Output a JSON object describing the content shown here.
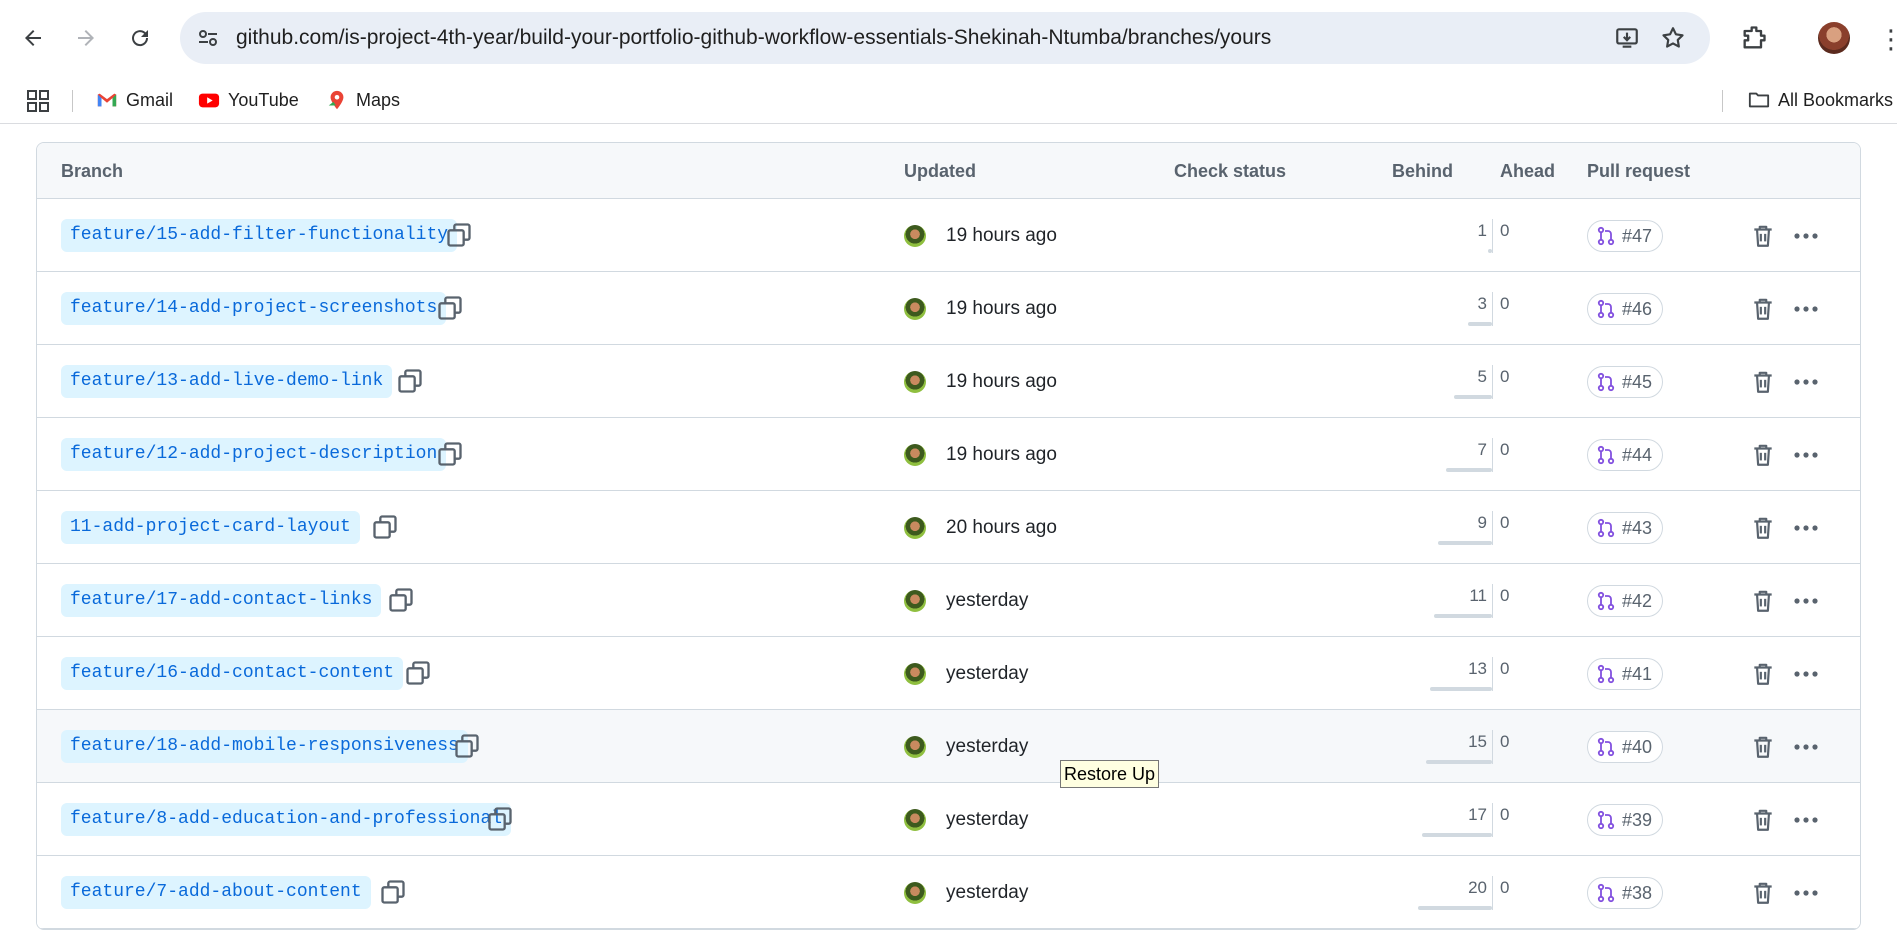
{
  "browser": {
    "url": "github.com/is-project-4th-year/build-your-portfolio-github-workflow-essentials-Shekinah-Ntumba/branches/yours",
    "bookmarks": [
      {
        "label": "Gmail",
        "icon": "gmail-icon"
      },
      {
        "label": "YouTube",
        "icon": "youtube-icon"
      },
      {
        "label": "Maps",
        "icon": "maps-icon"
      }
    ],
    "all_bookmarks_label": "All Bookmarks"
  },
  "table": {
    "headers": {
      "branch": "Branch",
      "updated": "Updated",
      "check_status": "Check status",
      "behind": "Behind",
      "ahead": "Ahead",
      "pull_request": "Pull request"
    },
    "rows": [
      {
        "branch": "feature/15-add-filter-functionality",
        "updated": "19 hours ago",
        "behind": "1",
        "ahead": "0",
        "pr": "#47"
      },
      {
        "branch": "feature/14-add-project-screenshots",
        "updated": "19 hours ago",
        "behind": "3",
        "ahead": "0",
        "pr": "#46"
      },
      {
        "branch": "feature/13-add-live-demo-link",
        "updated": "19 hours ago",
        "behind": "5",
        "ahead": "0",
        "pr": "#45"
      },
      {
        "branch": "feature/12-add-project-description",
        "updated": "19 hours ago",
        "behind": "7",
        "ahead": "0",
        "pr": "#44"
      },
      {
        "branch": "11-add-project-card-layout",
        "updated": "20 hours ago",
        "behind": "9",
        "ahead": "0",
        "pr": "#43"
      },
      {
        "branch": "feature/17-add-contact-links",
        "updated": "yesterday",
        "behind": "11",
        "ahead": "0",
        "pr": "#42"
      },
      {
        "branch": "feature/16-add-contact-content",
        "updated": "yesterday",
        "behind": "13",
        "ahead": "0",
        "pr": "#41"
      },
      {
        "branch": "feature/18-add-mobile-responsiveness",
        "updated": "yesterday",
        "behind": "15",
        "ahead": "0",
        "pr": "#40"
      },
      {
        "branch": "feature/8-add-education-and-professional",
        "updated": "yesterday",
        "behind": "17",
        "ahead": "0",
        "pr": "#39"
      },
      {
        "branch": "feature/7-add-about-content",
        "updated": "yesterday",
        "behind": "20",
        "ahead": "0",
        "pr": "#38"
      }
    ]
  },
  "tooltip": {
    "text": "Restore Up"
  },
  "colors": {
    "link": "#0969da",
    "pill_bg": "#ddf4ff",
    "pr_icon": "#8250df",
    "border": "#d1d9e0"
  }
}
